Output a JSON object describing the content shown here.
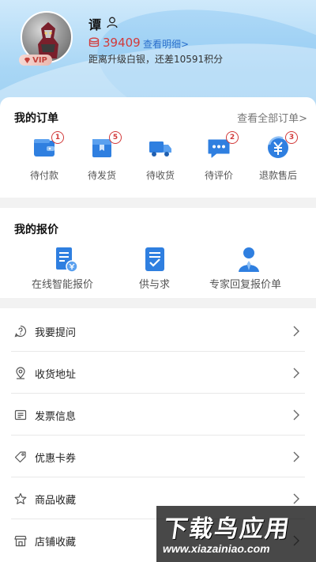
{
  "profile": {
    "username": "谭",
    "vip_label": "VIP",
    "points": "39409",
    "detail_link": "查看明细>",
    "upgrade_text": "距离升级白银，还差10591积分"
  },
  "orders": {
    "title": "我的订单",
    "view_all": "查看全部订单>",
    "items": [
      {
        "label": "待付款",
        "badge": "1",
        "icon": "wallet-icon"
      },
      {
        "label": "待发货",
        "badge": "5",
        "icon": "package-icon"
      },
      {
        "label": "待收货",
        "badge": "",
        "icon": "truck-icon"
      },
      {
        "label": "待评价",
        "badge": "2",
        "icon": "comment-icon"
      },
      {
        "label": "退款售后",
        "badge": "3",
        "icon": "refund-icon"
      }
    ]
  },
  "quotes": {
    "title": "我的报价",
    "items": [
      {
        "label": "在线智能报价",
        "icon": "quote-doc-icon"
      },
      {
        "label": "供与求",
        "icon": "checklist-icon"
      },
      {
        "label": "专家回复报价单",
        "icon": "expert-icon"
      }
    ]
  },
  "menu": {
    "items": [
      {
        "label": "我要提问",
        "icon": "question-icon"
      },
      {
        "label": "收货地址",
        "icon": "location-icon"
      },
      {
        "label": "发票信息",
        "icon": "invoice-icon"
      },
      {
        "label": "优惠卡券",
        "icon": "coupon-tag-icon"
      },
      {
        "label": "商品收藏",
        "icon": "star-icon"
      },
      {
        "label": "店铺收藏",
        "icon": "shop-icon"
      }
    ]
  },
  "watermark": {
    "title": "下载鸟应用",
    "url": "www.xiazainiao.com"
  },
  "colors": {
    "accent": "#2f7fe0",
    "badge": "#d23a3a",
    "header_top": "#cfe9fb",
    "header_bottom": "#9ccff2"
  }
}
